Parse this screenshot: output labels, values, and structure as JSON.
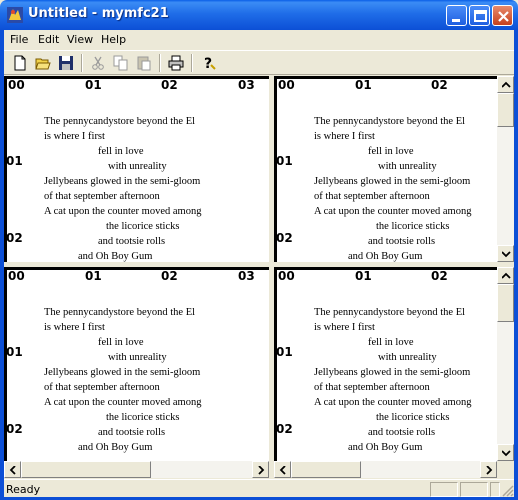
{
  "window": {
    "title": "Untitled - mymfc21"
  },
  "menu": {
    "items": [
      {
        "label": "File"
      },
      {
        "label": "Edit"
      },
      {
        "label": "View"
      },
      {
        "label": "Help"
      }
    ]
  },
  "toolbar": {
    "buttons": [
      {
        "name": "new-icon"
      },
      {
        "name": "open-icon"
      },
      {
        "name": "save-icon"
      },
      {
        "name": "cut-icon"
      },
      {
        "name": "copy-icon"
      },
      {
        "name": "paste-icon"
      },
      {
        "name": "print-icon"
      },
      {
        "name": "help-icon"
      }
    ]
  },
  "panes": {
    "top_labels_full": [
      "00",
      "01",
      "02",
      "03"
    ],
    "top_labels_right": [
      "00",
      "01",
      "02"
    ],
    "left_labels": [
      "00",
      "01",
      "02"
    ],
    "poem": [
      "The pennycandystore beyond the El",
      "is where I first",
      "fell in love",
      "with unreality",
      "Jellybeans glowed in the semi-gloom",
      "of that september afternoon",
      "A cat upon the counter moved among",
      "the licorice sticks",
      "and tootsie rolls",
      "and Oh Boy Gum"
    ]
  },
  "status": {
    "text": "Ready"
  },
  "colors": {
    "titlebar": "#0c4fd6",
    "pane_bg": "#ffffff",
    "chrome": "#ece9d8"
  }
}
